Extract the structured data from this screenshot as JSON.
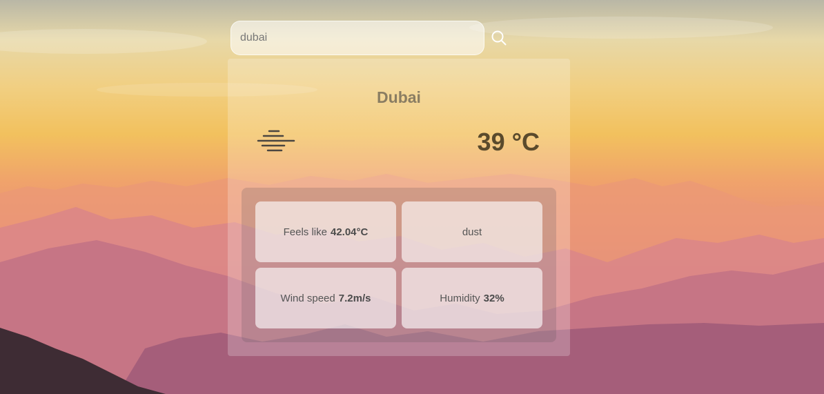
{
  "search": {
    "value": "dubai",
    "placeholder": ""
  },
  "search_button": {
    "icon": "search-icon"
  },
  "weather": {
    "city": "Dubai",
    "icon": "mist-icon",
    "temperature": "39 °C"
  },
  "details": {
    "feels_like_label": "Feels like",
    "feels_like_value": "42.04°C",
    "description": "dust",
    "wind_label": "Wind speed",
    "wind_value": "7.2m/s",
    "humidity_label": "Humidity",
    "humidity_value": "32%"
  },
  "colors": {
    "sky_top": "#b9b7a6",
    "sky_mid": "#f2c15e",
    "mountain": "#cf7f86",
    "temp_text": "#5a4a2c",
    "city_text": "#8a7d62"
  }
}
